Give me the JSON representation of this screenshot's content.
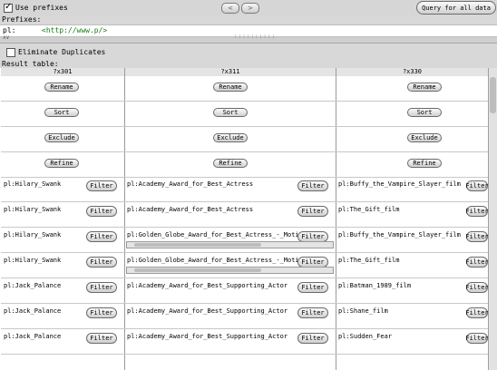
{
  "toolbar": {
    "use_prefixes_label": "Use prefixes",
    "use_prefixes_checked": true,
    "back_icon": "chevron-left-icon",
    "forward_icon": "chevron-right-icon",
    "query_all_label": "Query for all data"
  },
  "prefixes": {
    "label": "Prefixes:",
    "items": [
      {
        "prefix": "pl:",
        "uri": "<http://www.p/>"
      }
    ]
  },
  "eliminate_duplicates": {
    "label": "Eliminate Duplicates",
    "checked": false
  },
  "result_table": {
    "label": "Result table:",
    "columns": [
      "?x301",
      "?x311",
      "?x330"
    ],
    "actions": [
      "Rename",
      "Sort",
      "Exclude",
      "Refine"
    ],
    "filter_label": "Filter",
    "rows": [
      [
        "pl:Hilary_Swank",
        "pl:Academy_Award_for_Best_Actress",
        "pl:Buffy_the_Vampire_Slayer_film"
      ],
      [
        "pl:Hilary_Swank",
        "pl:Academy_Award_for_Best_Actress",
        "pl:The_Gift_film"
      ],
      [
        "pl:Hilary_Swank",
        "pl:Golden_Globe_Award_for_Best_Actress_-_Motio",
        "pl:Buffy_the_Vampire_Slayer_film"
      ],
      [
        "pl:Hilary_Swank",
        "pl:Golden_Globe_Award_for_Best_Actress_-_Motio",
        "pl:The_Gift_film"
      ],
      [
        "pl:Jack_Palance",
        "pl:Academy_Award_for_Best_Supporting_Actor",
        "pl:Batman_1989_film"
      ],
      [
        "pl:Jack_Palance",
        "pl:Academy_Award_for_Best_Supporting_Actor",
        "pl:Shane_film"
      ],
      [
        "pl:Jack_Palance",
        "pl:Academy_Award_for_Best_Supporting_Actor",
        "pl:Sudden_Fear"
      ]
    ]
  }
}
